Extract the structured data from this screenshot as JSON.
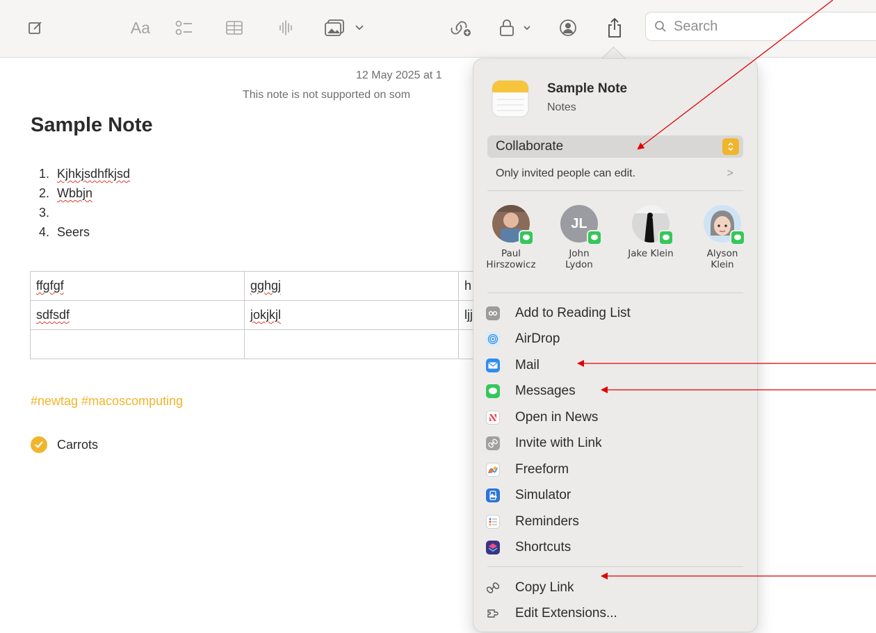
{
  "toolbar": {
    "search_placeholder": "Search",
    "format_label": "Aa"
  },
  "note": {
    "meta_date": "12 May 2025 at 1",
    "meta_support": "This note is not supported on som",
    "title": "Sample Note",
    "list": [
      {
        "num": "1.",
        "text": "Kjhkjsdhfkjsd"
      },
      {
        "num": "2.",
        "text": "Wbbjn"
      },
      {
        "num": "3.",
        "text": ""
      },
      {
        "num": "4.",
        "text": "Seers"
      }
    ],
    "table": [
      [
        "ffgfgf",
        "gghgj",
        "h"
      ],
      [
        "sdfsdf",
        "jokjkjl",
        "ljj"
      ],
      [
        "",
        "",
        ""
      ]
    ],
    "tags": "#newtag #macoscomputing",
    "checklist_item": "Carrots"
  },
  "share": {
    "title": "Sample Note",
    "subtitle": "Notes",
    "mode": "Collaborate",
    "permission": "Only invited people can edit.",
    "people": [
      {
        "name": "Paul\nHirszowicz",
        "initials": ""
      },
      {
        "name": "John\nLydon",
        "initials": "JL"
      },
      {
        "name": "Jake Klein",
        "initials": ""
      },
      {
        "name": "Alyson\nKlein",
        "initials": ""
      }
    ],
    "menu": [
      {
        "label": "Add to Reading List",
        "icon": "reading-list-icon"
      },
      {
        "label": "AirDrop",
        "icon": "airdrop-icon"
      },
      {
        "label": "Mail",
        "icon": "mail-icon"
      },
      {
        "label": "Messages",
        "icon": "messages-icon"
      },
      {
        "label": "Open in News",
        "icon": "news-icon"
      },
      {
        "label": "Invite with Link",
        "icon": "invite-link-icon"
      },
      {
        "label": "Freeform",
        "icon": "freeform-icon"
      },
      {
        "label": "Simulator",
        "icon": "simulator-icon"
      },
      {
        "label": "Reminders",
        "icon": "reminders-icon"
      },
      {
        "label": "Shortcuts",
        "icon": "shortcuts-icon"
      }
    ],
    "bottom_menu": [
      {
        "label": "Copy Link",
        "icon": "link-icon"
      },
      {
        "label": "Edit Extensions...",
        "icon": "extensions-icon"
      }
    ]
  },
  "colors": {
    "accent": "#f1b52c",
    "tag": "#f0b52a",
    "annotation": "#e00000"
  }
}
